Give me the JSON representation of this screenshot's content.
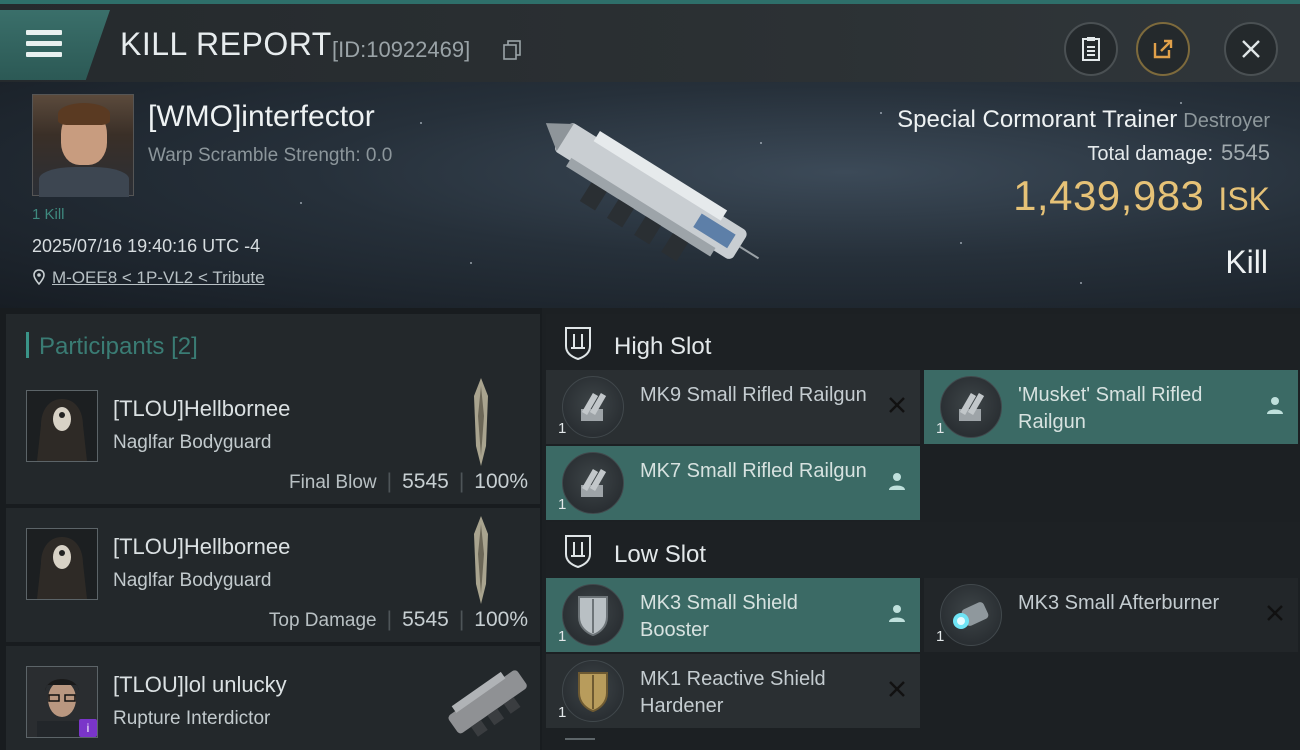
{
  "header": {
    "title": "KILL REPORT",
    "report_id": "[ID:10922469]"
  },
  "victim": {
    "name": "[WMO]interfector",
    "warp_scramble": "Warp Scramble Strength: 0.0",
    "kills": "1 Kill",
    "datetime": "2025/07/16 19:40:16 UTC -4",
    "location": "M-OEE8 < 1P-VL2 < Tribute"
  },
  "ship": {
    "name": "Special Cormorant Trainer",
    "class": "Destroyer",
    "total_damage_label": "Total damage:",
    "total_damage": "5545",
    "isk_value": "1,439,983",
    "isk_unit": "ISK",
    "result": "Kill"
  },
  "participants": {
    "label": "Participants",
    "count": "[2]",
    "rows": [
      {
        "name": "[TLOU]Hellbornee",
        "ship": "Naglfar Bodyguard",
        "role": "Final Blow",
        "damage": "5545",
        "percent": "100%"
      },
      {
        "name": "[TLOU]Hellbornee",
        "ship": "Naglfar Bodyguard",
        "role": "Top Damage",
        "damage": "5545",
        "percent": "100%"
      },
      {
        "name": "[TLOU]lol unlucky",
        "ship": "Rupture Interdictor",
        "role": "",
        "damage": "",
        "percent": ""
      }
    ]
  },
  "fitting": {
    "high_slot_label": "High Slot",
    "low_slot_label": "Low Slot",
    "high": [
      {
        "name": "MK9 Small Rifled Railgun",
        "qty": "1",
        "status": "destroyed"
      },
      {
        "name": "'Musket' Small Rifled Railgun",
        "qty": "1",
        "status": "dropped"
      },
      {
        "name": "MK7 Small Rifled Railgun",
        "qty": "1",
        "status": "dropped"
      }
    ],
    "low": [
      {
        "name": "MK3 Small Shield Booster",
        "qty": "1",
        "status": "dropped"
      },
      {
        "name": "MK3 Small Afterburner",
        "qty": "1",
        "status": "destroyed"
      },
      {
        "name": "MK1 Reactive Shield Hardener",
        "qty": "1",
        "status": "destroyed"
      }
    ]
  },
  "colors": {
    "accent_teal": "#3b6a65",
    "isk_gold": "#e6c277"
  }
}
